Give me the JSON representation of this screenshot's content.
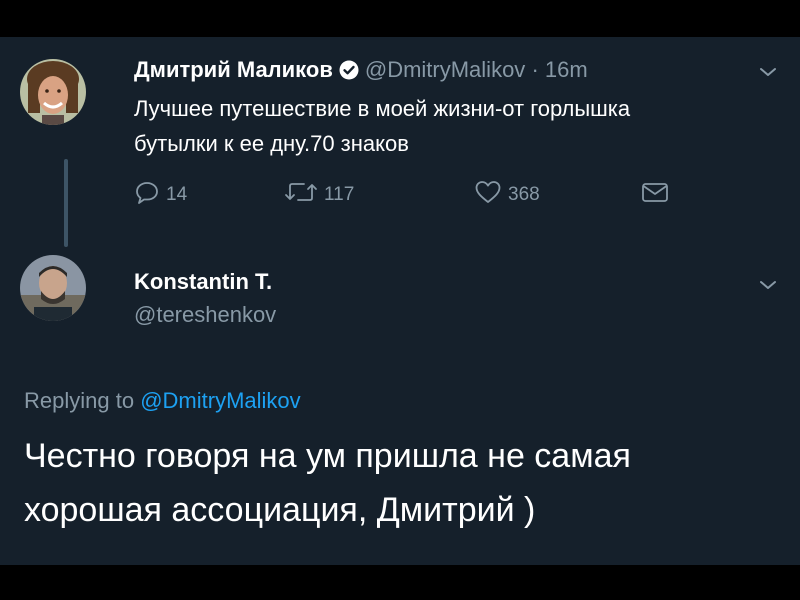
{
  "tweet": {
    "author_name": "Дмитрий Маликов",
    "author_handle": "@DmitryMalikov",
    "separator": "·",
    "time": "16m",
    "text": "Лучшее путешествие в моей жизни-от горлышка бутылки к ее дну.70 знаков",
    "verified_icon": "verified-badge-icon",
    "actions": {
      "replies": "14",
      "retweets": "117",
      "likes": "368"
    }
  },
  "reply": {
    "author_name": "Konstantin T.",
    "author_handle": "@tereshenkov",
    "replying_to_label": "Replying to",
    "replying_to_handle": "@DmitryMalikov",
    "text": "Честно говоря на ум пришла не самая хорошая ассоциация, Дмитрий )"
  },
  "colors": {
    "background": "#15202b",
    "text_primary": "#ffffff",
    "text_secondary": "#8899a6",
    "accent": "#1da1f2"
  }
}
